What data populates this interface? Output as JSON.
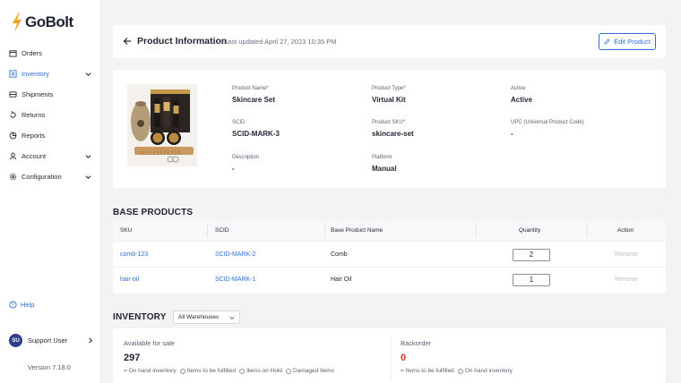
{
  "app": {
    "brand": "GoBolt",
    "version": "Version 7.18.0"
  },
  "sidebar": {
    "items": [
      {
        "label": "Orders",
        "icon": "box-icon",
        "active": false,
        "expandable": false
      },
      {
        "label": "Inventory",
        "icon": "inventory-icon",
        "active": true,
        "expandable": true
      },
      {
        "label": "Shipments",
        "icon": "truck-icon",
        "active": false,
        "expandable": false
      },
      {
        "label": "Returns",
        "icon": "return-icon",
        "active": false,
        "expandable": false
      },
      {
        "label": "Reports",
        "icon": "report-icon",
        "active": false,
        "expandable": false
      },
      {
        "label": "Account",
        "icon": "person-icon",
        "active": false,
        "expandable": true
      },
      {
        "label": "Configuration",
        "icon": "gear-icon",
        "active": false,
        "expandable": true
      }
    ],
    "help": "Help",
    "user": {
      "initials": "SU",
      "name": "Support User"
    }
  },
  "header": {
    "title": "Product Information",
    "updated": "Last updated April 27, 2023 10:35 PM",
    "edit_label": "Edit Product"
  },
  "product": {
    "name_label": "Product Name",
    "name": "Skincare Set",
    "type_label": "Product Type",
    "type": "Virtual Kit",
    "active_label": "Active",
    "active": "Active",
    "scid_label": "SCID",
    "scid": "SCID-MARK-3",
    "sku_label": "Product SKU",
    "sku": "skincare-set",
    "upc_label": "UPC (Universal Product Code)",
    "upc": "-",
    "description_label": "Description",
    "description": "-",
    "platform_label": "Platform",
    "platform": "Manual"
  },
  "base_products": {
    "title": "BASE PRODUCTS",
    "columns": {
      "sku": "SKU",
      "scid": "SCID",
      "name": "Base Product Name",
      "quantity": "Quantity",
      "action": "Action"
    },
    "rows": [
      {
        "sku": "comb-123",
        "scid": "SCID-MARK-2",
        "name": "Comb",
        "quantity": "2",
        "action": "Remove"
      },
      {
        "sku": "hair-oil",
        "scid": "SCID-MARK-1",
        "name": "Hair Oil",
        "quantity": "1",
        "action": "Remove"
      }
    ]
  },
  "inventory": {
    "title": "INVENTORY",
    "warehouse_select": "All Warehouses",
    "available": {
      "label": "Available for sale",
      "value": "297",
      "legend": [
        "= On hand inventory",
        "Items to be fulfilled",
        "Items on Hold",
        "Damaged Items"
      ]
    },
    "backorder": {
      "label": "Backorder",
      "value": "0",
      "legend": [
        "= Items to be fulfilled",
        "On hand inventory"
      ]
    }
  },
  "colors": {
    "accent": "#2f6fd6",
    "brand_bolt": "#f5a623",
    "backorder": "#e0342b"
  }
}
